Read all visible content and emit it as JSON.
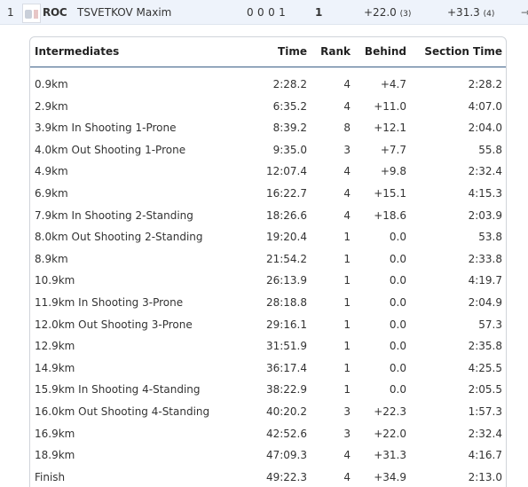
{
  "athlete": {
    "position": "1",
    "noc": "ROC",
    "name": "TSVETKOV Maxim",
    "shooting": "0 0 0 1",
    "penalties": "1",
    "behind": "+22.0",
    "behind_rank": "(3)",
    "shooting_time": "+31.3",
    "shooting_rank": "(4)",
    "expand_arrow": "→"
  },
  "table": {
    "headers": {
      "intermediates": "Intermediates",
      "time": "Time",
      "rank": "Rank",
      "behind": "Behind",
      "section_time": "Section Time"
    },
    "rows": [
      {
        "label": "0.9km",
        "time": "2:28.2",
        "rank": "4",
        "behind": "+4.7",
        "section": "2:28.2"
      },
      {
        "label": "2.9km",
        "time": "6:35.2",
        "rank": "4",
        "behind": "+11.0",
        "section": "4:07.0"
      },
      {
        "label": "3.9km In Shooting 1-Prone",
        "time": "8:39.2",
        "rank": "8",
        "behind": "+12.1",
        "section": "2:04.0"
      },
      {
        "label": "4.0km Out Shooting 1-Prone",
        "time": "9:35.0",
        "rank": "3",
        "behind": "+7.7",
        "section": "55.8"
      },
      {
        "label": "4.9km",
        "time": "12:07.4",
        "rank": "4",
        "behind": "+9.8",
        "section": "2:32.4"
      },
      {
        "label": "6.9km",
        "time": "16:22.7",
        "rank": "4",
        "behind": "+15.1",
        "section": "4:15.3"
      },
      {
        "label": "7.9km In Shooting 2-Standing",
        "time": "18:26.6",
        "rank": "4",
        "behind": "+18.6",
        "section": "2:03.9"
      },
      {
        "label": "8.0km Out Shooting 2-Standing",
        "time": "19:20.4",
        "rank": "1",
        "behind": "0.0",
        "section": "53.8"
      },
      {
        "label": "8.9km",
        "time": "21:54.2",
        "rank": "1",
        "behind": "0.0",
        "section": "2:33.8"
      },
      {
        "label": "10.9km",
        "time": "26:13.9",
        "rank": "1",
        "behind": "0.0",
        "section": "4:19.7"
      },
      {
        "label": "11.9km In Shooting 3-Prone",
        "time": "28:18.8",
        "rank": "1",
        "behind": "0.0",
        "section": "2:04.9"
      },
      {
        "label": "12.0km Out Shooting 3-Prone",
        "time": "29:16.1",
        "rank": "1",
        "behind": "0.0",
        "section": "57.3"
      },
      {
        "label": "12.9km",
        "time": "31:51.9",
        "rank": "1",
        "behind": "0.0",
        "section": "2:35.8"
      },
      {
        "label": "14.9km",
        "time": "36:17.4",
        "rank": "1",
        "behind": "0.0",
        "section": "4:25.5"
      },
      {
        "label": "15.9km In Shooting 4-Standing",
        "time": "38:22.9",
        "rank": "1",
        "behind": "0.0",
        "section": "2:05.5"
      },
      {
        "label": "16.0km Out Shooting 4-Standing",
        "time": "40:20.2",
        "rank": "3",
        "behind": "+22.3",
        "section": "1:57.3"
      },
      {
        "label": "16.9km",
        "time": "42:52.6",
        "rank": "3",
        "behind": "+22.0",
        "section": "2:32.4"
      },
      {
        "label": "18.9km",
        "time": "47:09.3",
        "rank": "4",
        "behind": "+31.3",
        "section": "4:16.7"
      },
      {
        "label": "Finish",
        "time": "49:22.3",
        "rank": "4",
        "behind": "+34.9",
        "section": "2:13.0"
      }
    ]
  }
}
